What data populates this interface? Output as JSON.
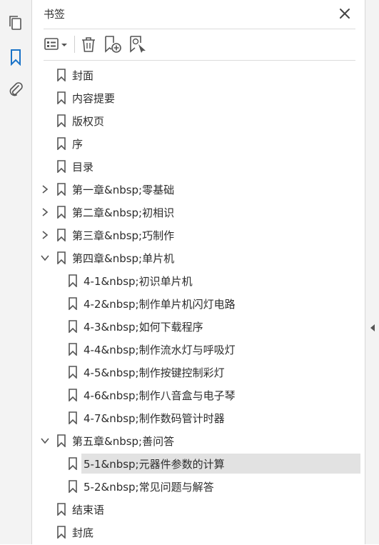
{
  "panel": {
    "title": "书签",
    "close_icon": "close-icon"
  },
  "leftbar": {
    "items": [
      "pages-icon",
      "bookmarks-icon",
      "attachments-icon"
    ]
  },
  "toolbar": {
    "buttons": [
      "options-menu-icon",
      "delete-icon",
      "new-bookmark-icon",
      "new-bookmark-from-structure-icon"
    ]
  },
  "bookmarks": [
    {
      "label": "封面",
      "level": 0,
      "expand": "none"
    },
    {
      "label": "内容提要",
      "level": 0,
      "expand": "none"
    },
    {
      "label": "版权页",
      "level": 0,
      "expand": "none"
    },
    {
      "label": "序",
      "level": 0,
      "expand": "none"
    },
    {
      "label": "目录",
      "level": 0,
      "expand": "none"
    },
    {
      "label": "第一章&nbsp;零基础",
      "level": 0,
      "expand": "collapsed"
    },
    {
      "label": "第二章&nbsp;初相识",
      "level": 0,
      "expand": "collapsed"
    },
    {
      "label": "第三章&nbsp;巧制作",
      "level": 0,
      "expand": "collapsed"
    },
    {
      "label": "第四章&nbsp;单片机",
      "level": 0,
      "expand": "expanded"
    },
    {
      "label": "4-1&nbsp;初识单片机",
      "level": 1,
      "expand": "none"
    },
    {
      "label": "4-2&nbsp;制作单片机闪灯电路",
      "level": 1,
      "expand": "none"
    },
    {
      "label": "4-3&nbsp;如何下载程序",
      "level": 1,
      "expand": "none"
    },
    {
      "label": "4-4&nbsp;制作流水灯与呼吸灯",
      "level": 1,
      "expand": "none"
    },
    {
      "label": "4-5&nbsp;制作按键控制彩灯",
      "level": 1,
      "expand": "none"
    },
    {
      "label": "4-6&nbsp;制作八音盒与电子琴",
      "level": 1,
      "expand": "none"
    },
    {
      "label": "4-7&nbsp;制作数码管计时器",
      "level": 1,
      "expand": "none"
    },
    {
      "label": "第五章&nbsp;善问答",
      "level": 0,
      "expand": "expanded"
    },
    {
      "label": "5-1&nbsp;元器件参数的计算",
      "level": 1,
      "expand": "none",
      "selected": true
    },
    {
      "label": "5-2&nbsp;常见问题与解答",
      "level": 1,
      "expand": "none"
    },
    {
      "label": "结束语",
      "level": 0,
      "expand": "none"
    },
    {
      "label": "封底",
      "level": 0,
      "expand": "none"
    }
  ]
}
